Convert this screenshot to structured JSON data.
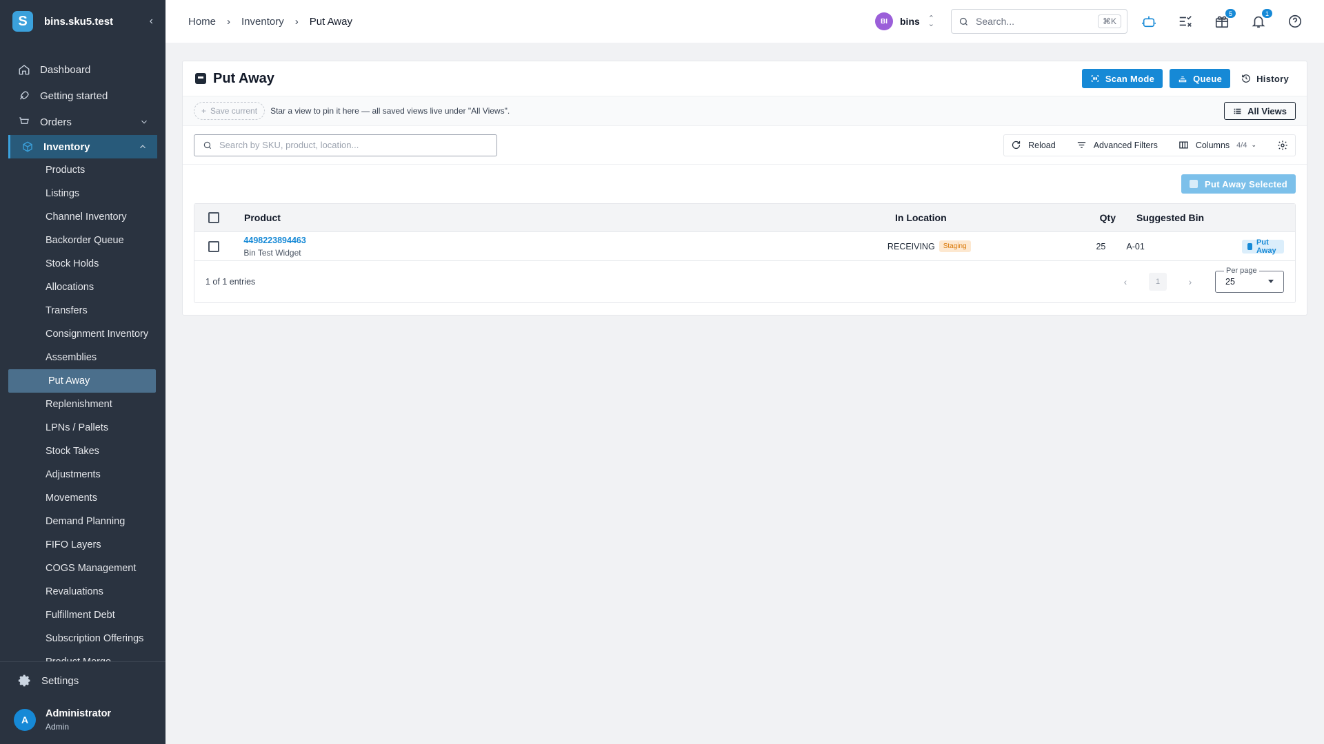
{
  "app": {
    "name": "bins.sku5.test",
    "logo_letter": "S"
  },
  "sidebar": {
    "top_items": [
      {
        "label": "Dashboard",
        "icon": "home-icon"
      },
      {
        "label": "Getting started",
        "icon": "rocket-icon"
      },
      {
        "label": "Orders",
        "icon": "cart-icon"
      }
    ],
    "group": {
      "label": "Inventory",
      "icon": "box-icon"
    },
    "sub_items": [
      "Products",
      "Listings",
      "Channel Inventory",
      "Backorder Queue",
      "Stock Holds",
      "Allocations",
      "Transfers",
      "Consignment Inventory",
      "Assemblies",
      "Put Away",
      "Replenishment",
      "LPNs / Pallets",
      "Stock Takes",
      "Adjustments",
      "Movements",
      "Demand Planning",
      "FIFO Layers",
      "COGS Management",
      "Revaluations",
      "Fulfillment Debt",
      "Subscription Offerings",
      "Product Merge"
    ],
    "active_sub": "Put Away",
    "settings_label": "Settings",
    "user": {
      "initial": "A",
      "name": "Administrator",
      "role": "Admin"
    }
  },
  "topbar": {
    "breadcrumb": [
      "Home",
      "Inventory",
      "Put Away"
    ],
    "tenant": {
      "initials": "BI",
      "name": "bins"
    },
    "search_placeholder": "Search...",
    "search_shortcut": "⌘K",
    "icons": [
      {
        "name": "robot-icon",
        "badge": ""
      },
      {
        "name": "checklist-icon",
        "badge": ""
      },
      {
        "name": "gift-icon",
        "badge": "5"
      },
      {
        "name": "bell-icon",
        "badge": "1"
      },
      {
        "name": "help-icon",
        "badge": ""
      }
    ],
    "accent": "#1689d6"
  },
  "page": {
    "title": "Put Away",
    "actions": {
      "scan_mode": "Scan Mode",
      "queue": "Queue",
      "history": "History"
    },
    "views": {
      "save_current": "Save current",
      "hint": "Star a view to pin it here — all saved views live under \"All Views\".",
      "all_views": "All Views"
    },
    "search_placeholder": "Search by SKU, product, location...",
    "toolbar": {
      "reload": "Reload",
      "filters": "Advanced Filters",
      "columns": "Columns",
      "columns_count": "4/4"
    },
    "bulk_action": "Put Away Selected",
    "table": {
      "headers": {
        "product": "Product",
        "location": "In Location",
        "qty": "Qty",
        "bin": "Suggested Bin"
      },
      "rows": [
        {
          "sku": "4498223894463",
          "name": "Bin Test Widget",
          "location": "RECEIVING",
          "location_tag": "Staging",
          "qty": "25",
          "bin": "A-01",
          "action": "Put Away"
        }
      ],
      "summary": "1 of 1 entries",
      "page": "1",
      "per_page_label": "Per page",
      "per_page": "25"
    }
  }
}
